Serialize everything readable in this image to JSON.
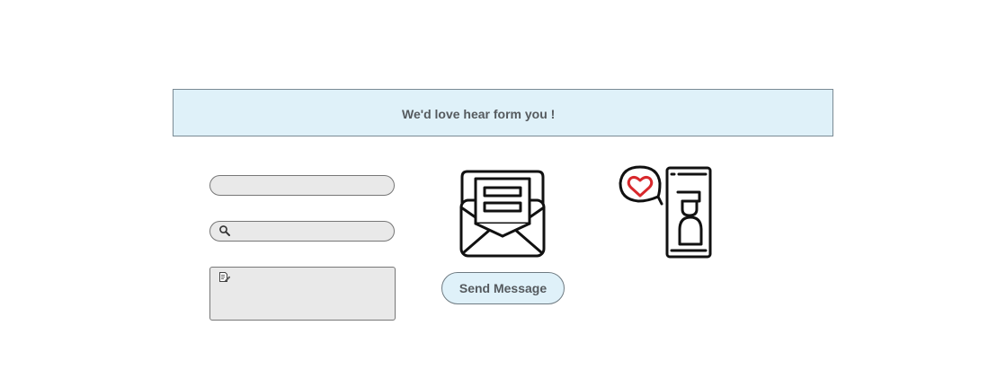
{
  "banner": {
    "text": "We'd love hear form you !",
    "background": "#dff1f9"
  },
  "form": {
    "name_field": {
      "value": "",
      "placeholder": ""
    },
    "search_field": {
      "value": "",
      "placeholder": "",
      "icon": "search-icon"
    },
    "message_field": {
      "value": "",
      "placeholder": "",
      "icon": "edit-icon"
    }
  },
  "actions": {
    "send_label": "Send Message"
  },
  "illustrations": {
    "envelope": "open-envelope-icon",
    "contact": "phone-contact-heart-icon",
    "accent_color": "#d8282c"
  }
}
